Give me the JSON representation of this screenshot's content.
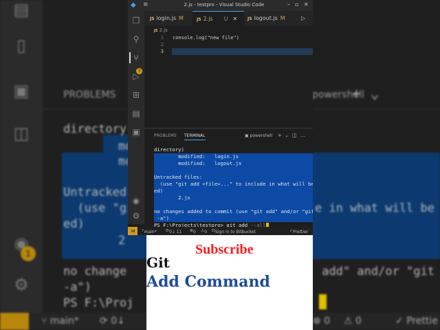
{
  "background": {
    "panel_tab": "PROBLEMS",
    "shell": "powershell",
    "lines": [
      "directory)",
      "mo",
      "mo",
      "Untracked",
      "  (use \"git",
      "ed)",
      "2",
      "no change",
      "-a\")",
      "PS F:\\Proj"
    ],
    "right_lines": [
      " add\" and/or \"git",
      "e in what will be"
    ],
    "badge": "1",
    "status": {
      "branch": "main*",
      "sync": "0↓",
      "errors": "0",
      "warnings": "0",
      "prettier": "Prettie"
    }
  },
  "window": {
    "title": "2.js - testpro - Visual Studio Code",
    "tabs": [
      {
        "name": "login.js",
        "status": "M"
      },
      {
        "name": "2.js",
        "status": "U"
      },
      {
        "name": "logout.js",
        "status": "M"
      }
    ],
    "breadcrumb": "2.js",
    "editor": {
      "line_numbers": [
        "1",
        "2",
        "3"
      ],
      "lines": [
        "console.log(\"new file\")",
        "",
        ""
      ]
    },
    "panel": {
      "tabs": [
        "PROBLEMS",
        "TERMINAL"
      ],
      "shell": "powershell",
      "terminal_lines": [
        "directory)",
        "        modified:   login.js",
        "        modified:   logout.js",
        "",
        "Untracked files:",
        "  (use \"git add <file>...\" to include in what will be",
        "ed)",
        "        2.js",
        "",
        "no changes added to commit (use \"git add\" and/or \"git",
        " -a\")"
      ],
      "prompt": "PS F:\\Projects\\testpro> git add ",
      "typed": "--all"
    },
    "statusbar": {
      "branch": "main*",
      "sync": "0↓ 11",
      "errors": "0",
      "warnings": "0",
      "bitbucket": "Sign in to Bitbucket",
      "prettier": "Prettier"
    },
    "scm_badge": "3"
  },
  "card": {
    "subscribe": "Subscribe",
    "line1": "Git",
    "line2": "Add Command"
  }
}
